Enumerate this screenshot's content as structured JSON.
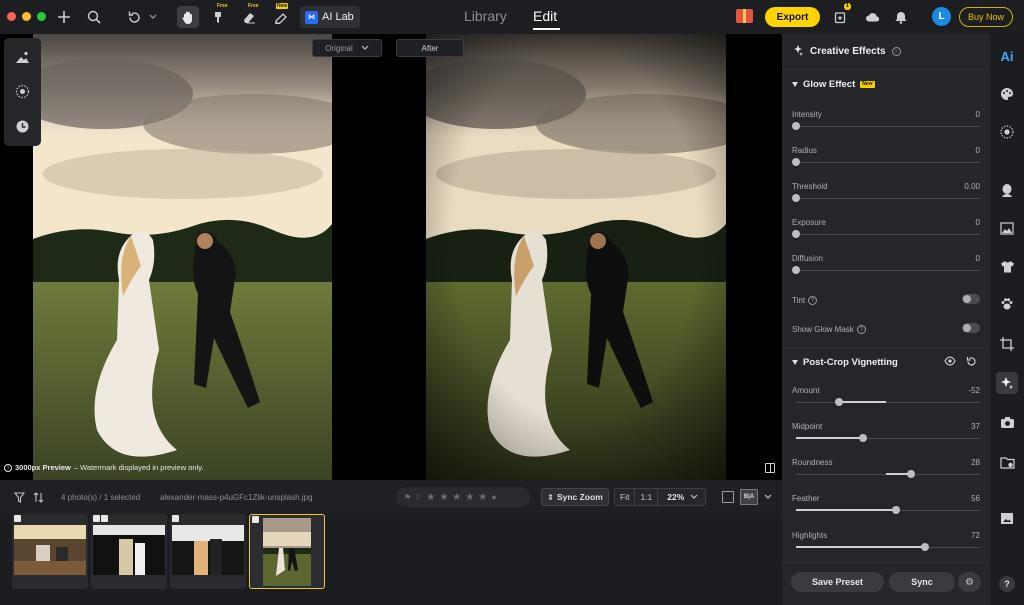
{
  "topbar": {
    "free_badge_1": "Free",
    "free_badge_2": "Free",
    "new_badge": "New",
    "ai_lab_label": "AI Lab",
    "nav_library": "Library",
    "nav_edit": "Edit",
    "export_label": "Export",
    "notification_count": "1",
    "avatar_initial": "L",
    "buy_now_label": "Buy Now"
  },
  "canvas": {
    "view_mode": "Original",
    "after_label": "After",
    "preview_highlight": "3000px Preview",
    "preview_rest": " – Watermark displayed in preview only."
  },
  "filmbar": {
    "selection_count": "4 photo(s) / 1 selected",
    "filename": "alexander-mass-p4uGFc1Zlik-unsplash.jpg",
    "sync_zoom_label": "Sync Zoom",
    "zoom_fit": "Fit",
    "zoom_1to1": "1:1",
    "zoom_value": "22%",
    "view_ba": "B|A"
  },
  "panel": {
    "title": "Creative Effects",
    "glow": {
      "title": "Glow Effect",
      "new_tag": "New",
      "sliders": [
        {
          "label": "Intensity",
          "value": "0"
        },
        {
          "label": "Radius",
          "value": "0"
        },
        {
          "label": "Threshold",
          "value": "0.00"
        },
        {
          "label": "Exposure",
          "value": "0"
        },
        {
          "label": "Diffusion",
          "value": "0"
        }
      ],
      "tint_label": "Tint",
      "show_mask_label": "Show Glow Mask"
    },
    "vignette": {
      "title": "Post-Crop Vignetting",
      "sliders": [
        {
          "label": "Amount",
          "value": "-52"
        },
        {
          "label": "Midpoint",
          "value": "37"
        },
        {
          "label": "Roundness",
          "value": "28"
        },
        {
          "label": "Feather",
          "value": "56"
        },
        {
          "label": "Highlights",
          "value": "72"
        }
      ]
    },
    "save_preset_label": "Save Preset",
    "sync_label": "Sync"
  },
  "rail": {
    "ai_label": "Ai",
    "help_label": "?"
  },
  "colors": {
    "accent_yellow": "#ffd400",
    "panel_bg": "#25262a",
    "avatar_blue": "#1e88e5"
  }
}
